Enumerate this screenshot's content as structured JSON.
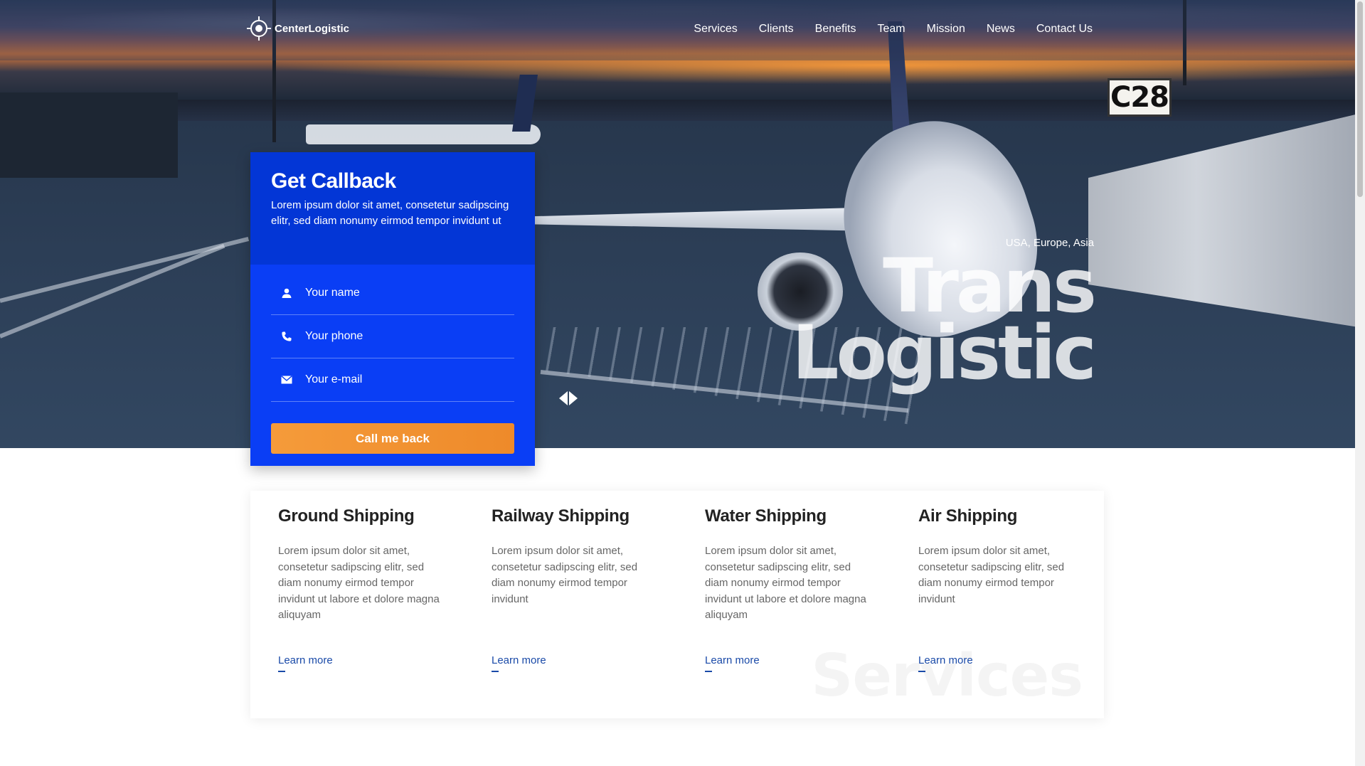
{
  "nav": {
    "brand": "CenterLogistic",
    "links": [
      "Services",
      "Clients",
      "Benefits",
      "Team",
      "Mission",
      "News",
      "Contact Us"
    ]
  },
  "hero": {
    "tagline": "USA, Europe, Asia",
    "title_line1": "Trans",
    "title_line2": "Logistic",
    "gate_sign": "C28",
    "icons": {
      "prev": "arrow-left-icon",
      "next": "arrow-right-icon"
    }
  },
  "callback": {
    "title": "Get Callback",
    "description": "Lorem ipsum dolor sit amet, consetetur sadipscing elitr, sed diam nonumy eirmod tempor invidunt ut",
    "fields": {
      "name_placeholder": "Your name",
      "phone_placeholder": "Your phone",
      "email_placeholder": "Your e-mail"
    },
    "button": "Call me back"
  },
  "services": {
    "watermark": "Services",
    "items": [
      {
        "title": "Ground Shipping",
        "text": "Lorem ipsum dolor sit amet, consetetur sadipscing elitr, sed diam nonumy eirmod tempor invidunt ut labore et dolore magna aliquyam",
        "link": "Learn more"
      },
      {
        "title": "Railway Shipping",
        "text": "Lorem ipsum dolor sit amet, consetetur sadipscing elitr, sed diam nonumy eirmod tempor invidunt",
        "link": "Learn more"
      },
      {
        "title": "Water Shipping",
        "text": "Lorem ipsum dolor sit amet, consetetur sadipscing elitr, sed diam nonumy eirmod tempor invidunt ut labore et dolore magna aliquyam",
        "link": "Learn more"
      },
      {
        "title": "Air Shipping",
        "text": "Lorem ipsum dolor sit amet, consetetur sadipscing elitr, sed diam nonumy eirmod tempor invidunt",
        "link": "Learn more"
      }
    ]
  },
  "colors": {
    "callback_bg": "#0a3ef5",
    "callback_header": "#0336d6",
    "button_orange": "#f59b3a",
    "link_blue": "#1a4aa8"
  }
}
